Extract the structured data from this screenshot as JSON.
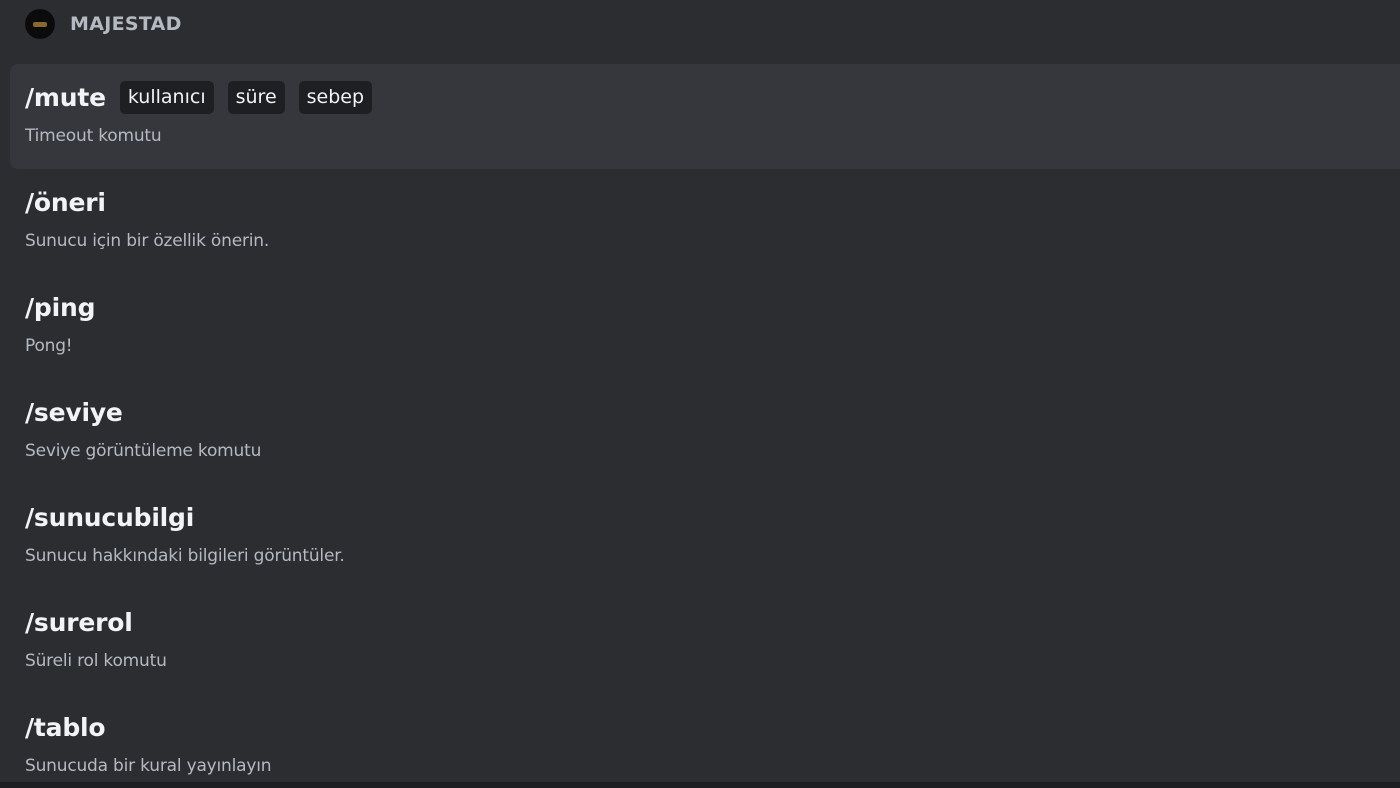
{
  "app": {
    "name": "MAJESTAD"
  },
  "commands": [
    {
      "name": "/mute",
      "params": [
        "kullanıcı",
        "süre",
        "sebep"
      ],
      "description": "Timeout komutu",
      "selected": true
    },
    {
      "name": "/öneri",
      "params": [],
      "description": "Sunucu için bir özellik önerin.",
      "selected": false
    },
    {
      "name": "/ping",
      "params": [],
      "description": "Pong!",
      "selected": false
    },
    {
      "name": "/seviye",
      "params": [],
      "description": "Seviye görüntüleme komutu",
      "selected": false
    },
    {
      "name": "/sunucubilgi",
      "params": [],
      "description": "Sunucu hakkındaki bilgileri görüntüler.",
      "selected": false
    },
    {
      "name": "/surerol",
      "params": [],
      "description": "Süreli rol komutu",
      "selected": false
    },
    {
      "name": "/tablo",
      "params": [],
      "description": "Sunucuda bir kural yayınlayın",
      "selected": false
    }
  ]
}
